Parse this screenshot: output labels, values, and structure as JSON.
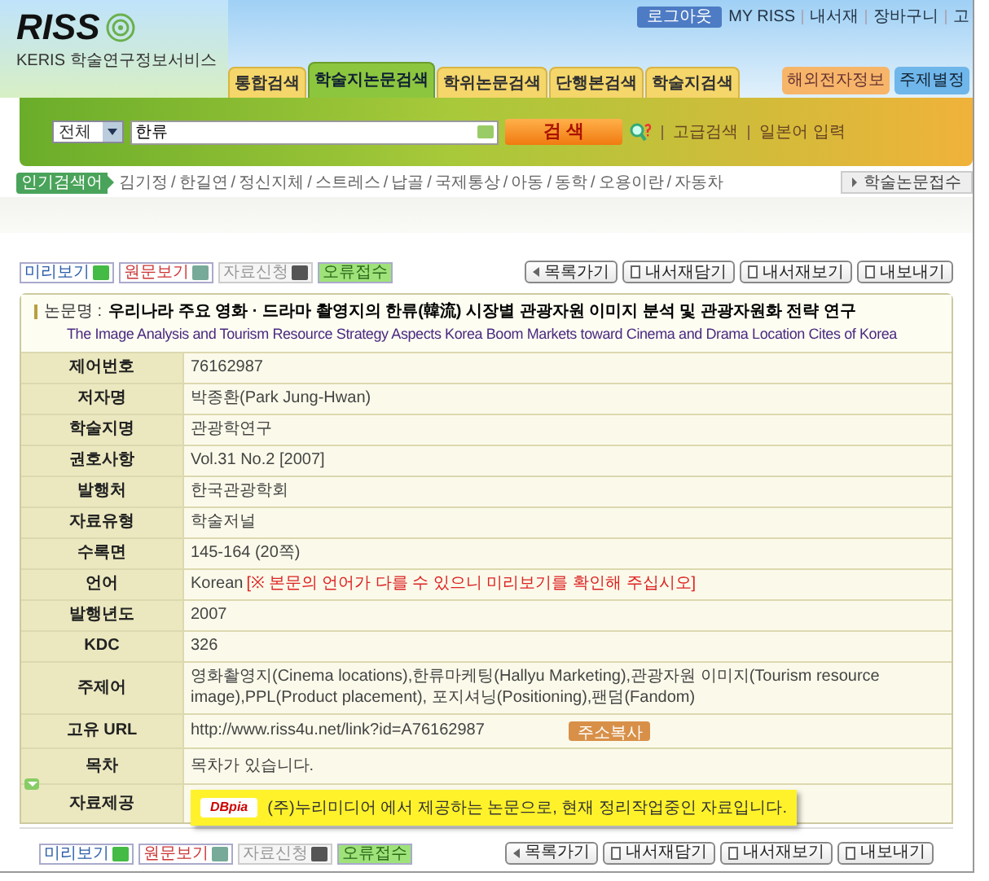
{
  "header": {
    "logo": "RISS",
    "subtitle": "KERIS 학술연구정보서비스",
    "logout": "로그아웃",
    "top_links": [
      "MY RISS",
      "내서재",
      "장바구니",
      "고"
    ],
    "tabs": [
      {
        "label": "통합검색",
        "selected": false
      },
      {
        "label": "학술지논문검색",
        "selected": true
      },
      {
        "label": "학위논문검색",
        "selected": false
      },
      {
        "label": "단행본검색",
        "selected": false
      },
      {
        "label": "학술지검색",
        "selected": false
      }
    ],
    "side_buttons": [
      "해외전자정보",
      "주제별정"
    ]
  },
  "search": {
    "scope": "전체",
    "value": "한류",
    "button": "검 색",
    "links": [
      "고급검색",
      "일본어 입력"
    ]
  },
  "popular": {
    "label": "인기검색어",
    "separator": "/",
    "terms": [
      "김기정",
      "한길연",
      "정신지체",
      "스트레스",
      "납골",
      "국제통상",
      "아동",
      "동학",
      "오용이란",
      "자동차"
    ],
    "side_button": "학술논문접수"
  },
  "toolbar_top": {
    "left": [
      {
        "label": "미리보기",
        "kind": "preview",
        "disabled": false
      },
      {
        "label": "원문보기",
        "kind": "fulltext",
        "disabled": false
      },
      {
        "label": "자료신청",
        "kind": "request",
        "disabled": true
      },
      {
        "label": "오류접수",
        "kind": "error",
        "disabled": false
      }
    ],
    "right": [
      {
        "label": "목록가기",
        "kind": "back"
      },
      {
        "label": "내서재담기",
        "kind": "save"
      },
      {
        "label": "내서재보기",
        "kind": "doc"
      },
      {
        "label": "내보내기",
        "kind": "export"
      }
    ]
  },
  "paper": {
    "label": "논문명 :",
    "title": "우리나라 주요 영화 · 드라마 촬영지의 한류(韓流) 시장별 관광자원 이미지 분석 및 관광자원화 전략 연구",
    "title_en": "The Image Analysis and Tourism Resource Strategy Aspects Korea Boom Markets toward Cinema and Drama Location Cites of Korea"
  },
  "rows": [
    {
      "label": "제어번호",
      "value": "76162987"
    },
    {
      "label": "저자명",
      "value": "박종환(Park Jung-Hwan)"
    },
    {
      "label": "학술지명",
      "value": "관광학연구"
    },
    {
      "label": "권호사항",
      "value": "Vol.31 No.2 [2007]"
    },
    {
      "label": "발행처",
      "value": "한국관광학회"
    },
    {
      "label": "자료유형",
      "value": "학술저널"
    },
    {
      "label": "수록면",
      "value": "145-164 (20쪽)"
    },
    {
      "label": "언어",
      "value": "Korean",
      "note": "[※ 본문의 언어가 다를 수 있으니 미리보기를 확인해 주십시오]"
    },
    {
      "label": "발행년도",
      "value": "2007"
    },
    {
      "label": "KDC",
      "value": "326"
    },
    {
      "label": "주제어",
      "value": "영화촬영지(Cinema locations),한류마케팅(Hallyu Marketing),관광자원 이미지(Tourism resource image),PPL(Product placement), 포지셔닝(Positioning),팬덤(Fandom)"
    },
    {
      "label": "고유 URL",
      "value": "http://www.riss4u.net/link?id=A76162987",
      "button": "주소복사"
    },
    {
      "label": "목차",
      "value": "목차가 있습니다.",
      "toggle": true
    }
  ],
  "provider": {
    "label": "자료제공",
    "logo": "DBpia",
    "message": "(주)누리미디어 에서 제공하는 논문으로, 현재 정리작업중인 자료입니다."
  },
  "toolbar_bottom": {
    "left": [
      {
        "label": "미리보기",
        "kind": "preview",
        "disabled": false
      },
      {
        "label": "원문보기",
        "kind": "fulltext",
        "disabled": false
      },
      {
        "label": "자료신청",
        "kind": "request",
        "disabled": true
      },
      {
        "label": "오류접수",
        "kind": "error",
        "disabled": false
      }
    ],
    "right": [
      {
        "label": "목록가기",
        "kind": "back"
      },
      {
        "label": "내서재담기",
        "kind": "save"
      },
      {
        "label": "내서재보기",
        "kind": "doc"
      },
      {
        "label": "내보내기",
        "kind": "export"
      }
    ]
  }
}
